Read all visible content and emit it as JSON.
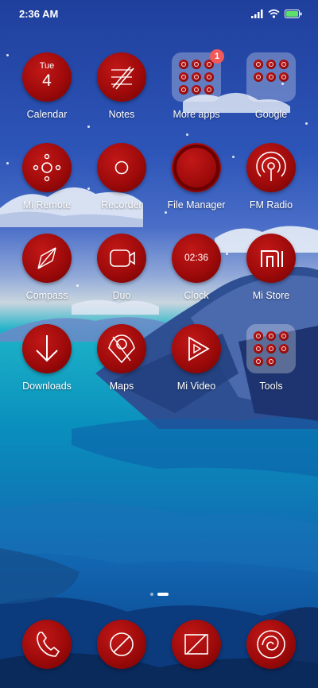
{
  "status": {
    "time": "2:36 AM",
    "icons": [
      "signal-icon",
      "wifi-icon",
      "battery-icon"
    ]
  },
  "colors": {
    "icon_red": "#a00a0a",
    "badge_red": "#f05a5a"
  },
  "apps": {
    "calendar": {
      "label": "Calendar",
      "day": "Tue",
      "date": "4"
    },
    "notes": {
      "label": "Notes"
    },
    "more_apps": {
      "label": "More apps",
      "badge": "1"
    },
    "google": {
      "label": "Google"
    },
    "mi_remote": {
      "label": "Mi Remote"
    },
    "recorder": {
      "label": "Recorder"
    },
    "file_manager": {
      "label": "File Manager"
    },
    "fm_radio": {
      "label": "FM Radio"
    },
    "compass": {
      "label": "Compass"
    },
    "duo": {
      "label": "Duo"
    },
    "clock": {
      "label": "Clock",
      "time": "02:36"
    },
    "mi_store": {
      "label": "Mi Store"
    },
    "downloads": {
      "label": "Downloads"
    },
    "maps": {
      "label": "Maps"
    },
    "mi_video": {
      "label": "Mi Video"
    },
    "tools": {
      "label": "Tools"
    }
  },
  "page_indicator": {
    "pages": 2,
    "active": 2
  },
  "dock": [
    "phone-icon",
    "messaging-icon",
    "camera-icon",
    "browser-icon"
  ]
}
